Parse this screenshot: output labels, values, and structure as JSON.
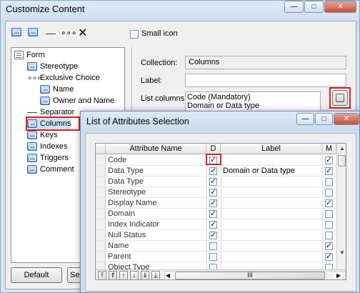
{
  "window": {
    "title": "Customize Content",
    "controls": {
      "minimize": "—",
      "maximize": "□",
      "close": "✕"
    }
  },
  "toolbar": {
    "icons": [
      "table-icon",
      "table-icon",
      "dash-icon",
      "dots-icon",
      "x-icon"
    ],
    "small_icon_label": "Small icon",
    "small_icon_checked": false
  },
  "tree": {
    "items": [
      {
        "label": "Form",
        "icon": "form-icon"
      },
      {
        "label": "Stereotype",
        "icon": "table-icon"
      },
      {
        "label": "Exclusive Choice",
        "icon": "dots-icon"
      },
      {
        "label": "Name",
        "icon": "table-icon"
      },
      {
        "label": "Owner and Name",
        "icon": "table-icon"
      },
      {
        "label": "Separator",
        "icon": "dash-icon"
      },
      {
        "label": "Columns",
        "icon": "table-icon"
      },
      {
        "label": "Keys",
        "icon": "table-icon"
      },
      {
        "label": "Indexes",
        "icon": "table-icon"
      },
      {
        "label": "Triggers",
        "icon": "table-icon"
      },
      {
        "label": "Comment",
        "icon": "table-icon"
      }
    ]
  },
  "panel": {
    "collection_label": "Collection:",
    "collection_value": "Columns",
    "label_label": "Label:",
    "label_value": "",
    "list_columns_label": "List columns:",
    "list_columns_values": [
      "Code (Mandatory)",
      "Domain or Data type"
    ]
  },
  "buttons": {
    "default": "Default",
    "set_partial": "Set"
  },
  "dialog": {
    "title": "List of Attributes Selection",
    "controls": {
      "minimize": "—",
      "maximize": "□",
      "close": "✕"
    },
    "columns": [
      "Attribute Name",
      "D",
      "Label",
      "M"
    ],
    "rows": [
      {
        "name": "Code",
        "d": true,
        "label": "",
        "m": true
      },
      {
        "name": "Data Type",
        "d": true,
        "label": "Domain or Data type",
        "m": true
      },
      {
        "name": "Data Type",
        "d": true,
        "label": "",
        "m": false
      },
      {
        "name": "Stereotype",
        "d": true,
        "label": "",
        "m": false
      },
      {
        "name": "Display Name",
        "d": true,
        "label": "",
        "m": true
      },
      {
        "name": "Domain",
        "d": true,
        "label": "",
        "m": false
      },
      {
        "name": "Index Indicator",
        "d": true,
        "label": "",
        "m": false
      },
      {
        "name": "Null Status",
        "d": true,
        "label": "",
        "m": false
      },
      {
        "name": "Name",
        "d": false,
        "label": "",
        "m": true
      },
      {
        "name": "Parent",
        "d": false,
        "label": "",
        "m": true
      },
      {
        "name": "Object Type",
        "d": false,
        "label": "",
        "m": false
      }
    ],
    "nav_buttons": [
      "⤒",
      "⇑",
      "↑",
      "↓",
      "⇓",
      "⤓"
    ],
    "hscroll_grip": "III"
  }
}
